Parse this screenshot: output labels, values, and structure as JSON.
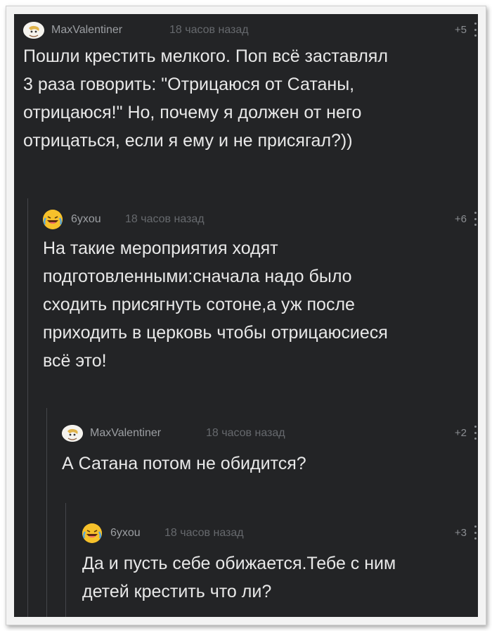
{
  "comments": [
    {
      "author": "MaxValentiner",
      "time": "18 часов назад",
      "score": "+5",
      "avatar_icon": "cartoon-avatar-icon",
      "text": "Пошли крестить мелкого. Поп всё заставлял\n3 раза говорить: \"Отрицаюся от Сатаны,\nотрицаюся!\" Но, почему я должен от него\nотрицаться, если я ему и не присягал?))"
    },
    {
      "author": "6yxou",
      "time": "18 часов назад",
      "score": "+6",
      "avatar_icon": "laughing-crying-emoji-icon",
      "text": "На такие мероприятия ходят\nподготовленными:сначала надо было\nсходить присягнуть сотоне,а уж после\nприходить в церковь чтобы отрицаюсиеся\nвсё это!"
    },
    {
      "author": "MaxValentiner",
      "time": "18 часов назад",
      "score": "+2",
      "avatar_icon": "cartoon-avatar-icon",
      "text": "А Сатана потом не обидится?"
    },
    {
      "author": "6yxou",
      "time": "18 часов назад",
      "score": "+3",
      "avatar_icon": "laughing-crying-emoji-icon",
      "text": "Да и пусть себе обижается.Тебе с ним\nдетей крестить что ли?"
    }
  ]
}
